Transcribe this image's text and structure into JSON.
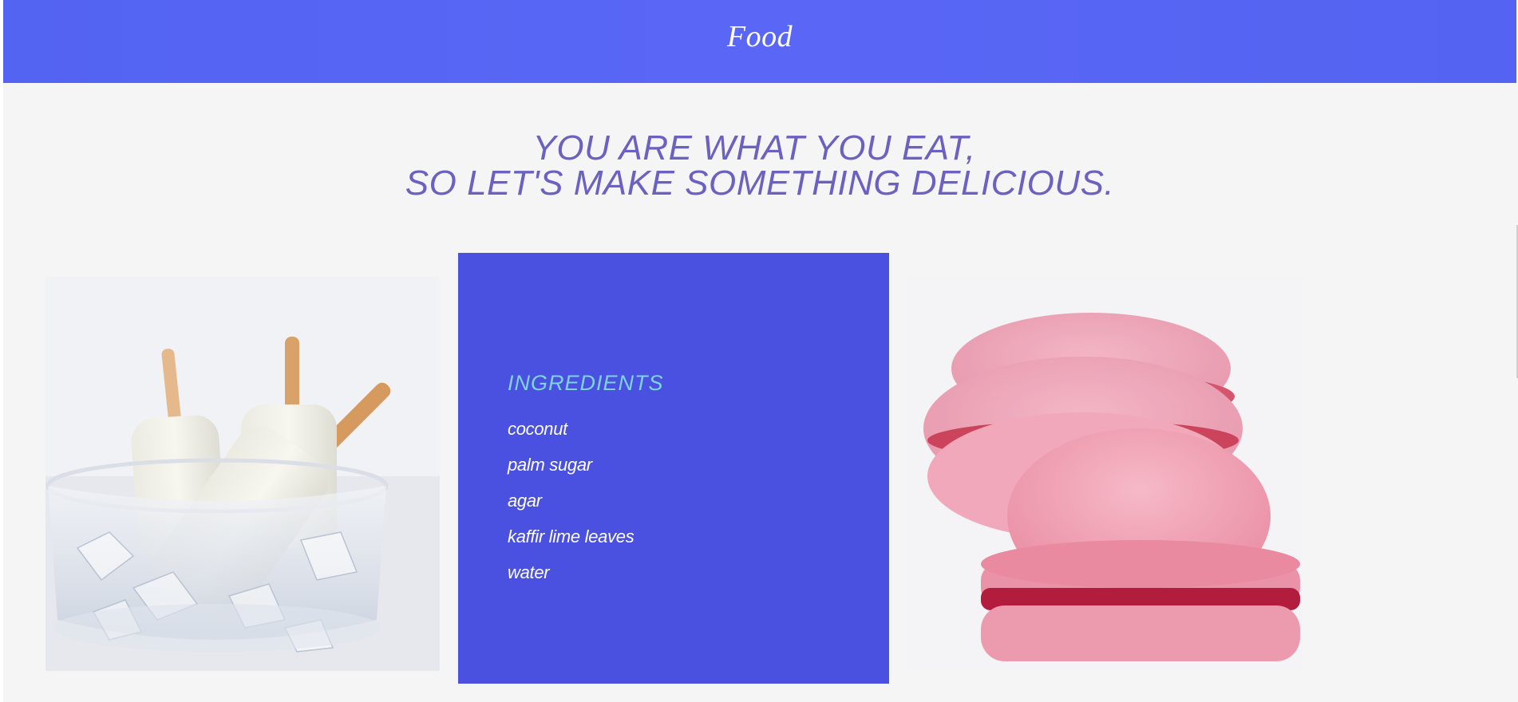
{
  "header": {
    "title": "Food"
  },
  "hero": {
    "line1": "YOU ARE WHAT YOU EAT,",
    "line2": "SO LET'S MAKE SOMETHING DELICIOUS."
  },
  "ingredients_card": {
    "title": "INGREDIENTS",
    "items": [
      "coconut",
      "palm sugar",
      "agar",
      "kaffir lime leaves",
      "water"
    ]
  },
  "colors": {
    "header_bg": "#5666f4",
    "headline": "#6b61c1",
    "card_bg": "#4a50e0",
    "card_title": "#7dd3e0",
    "page_bg": "#f5f5f5"
  }
}
